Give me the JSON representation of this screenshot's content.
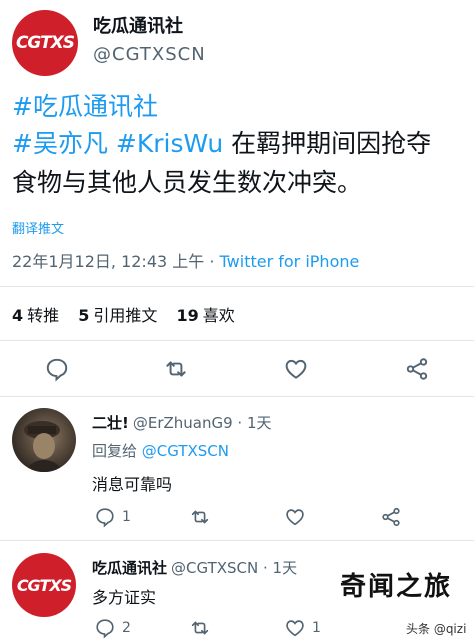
{
  "tweet": {
    "avatar_text": "CGTXS",
    "display_name": "吃瓜通讯社",
    "handle": "@CGTXSCN",
    "line1_tag": "#吃瓜通讯社",
    "line2_tag1": "#吴亦凡",
    "line2_tag2": "#KrisWu",
    "line2_text": " 在羁押期间因抢夺",
    "line3_text": "食物与其他人员发生数次冲突。",
    "translate_label": "翻译推文",
    "timestamp": "22年1月12日, 12:43 上午 · ",
    "source": "Twitter for iPhone",
    "stats": {
      "retweets_count": "4",
      "retweets_label": "转推",
      "quotes_count": "5",
      "quotes_label": "引用推文",
      "likes_count": "19",
      "likes_label": "喜欢"
    }
  },
  "replies": [
    {
      "display_name": "二壮!",
      "handle": "@ErZhuanG9 · 1天",
      "replying_label": "回复给 ",
      "replying_to": "@CGTXSCN",
      "text": "消息可靠吗",
      "reply_count": "1",
      "retweet_count": "",
      "like_count": ""
    },
    {
      "avatar_text": "CGTXS",
      "display_name": "吃瓜通讯社",
      "handle": "@CGTXSCN · 1天",
      "text": "多方证实",
      "reply_count": "2",
      "retweet_count": "",
      "like_count": "1"
    }
  ],
  "watermark": {
    "main": "奇闻之旅",
    "sub": "头条 @qizi"
  },
  "colors": {
    "accent": "#1d9bf0",
    "brand_red": "#cf1f2a",
    "muted": "#536471"
  }
}
